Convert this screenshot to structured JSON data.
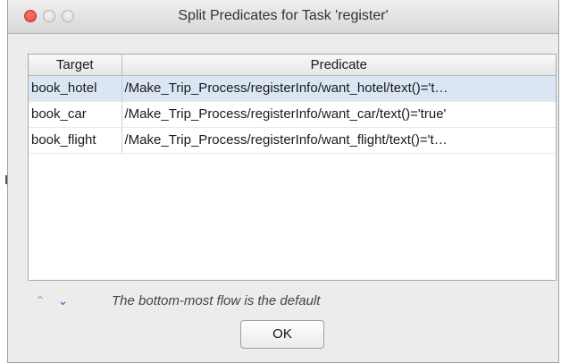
{
  "window": {
    "title": "Split Predicates for Task 'register'"
  },
  "table": {
    "columns": [
      "Target",
      "Predicate"
    ],
    "rows": [
      {
        "target": "book_hotel",
        "predicate": "/Make_Trip_Process/registerInfo/want_hotel/text()='t…",
        "selected": true
      },
      {
        "target": "book_car",
        "predicate": "/Make_Trip_Process/registerInfo/want_car/text()='true'",
        "selected": false
      },
      {
        "target": "book_flight",
        "predicate": "/Make_Trip_Process/registerInfo/want_flight/text()='t…",
        "selected": false
      }
    ]
  },
  "footer": {
    "up_icon": "chevron-up-icon",
    "down_icon": "chevron-down-icon",
    "hint": "The bottom-most flow is the default",
    "ok_label": "OK"
  },
  "colors": {
    "selected_row": "#dbe6f5",
    "arrow_down": "#2a66c8",
    "close_button": "#e0443a"
  }
}
